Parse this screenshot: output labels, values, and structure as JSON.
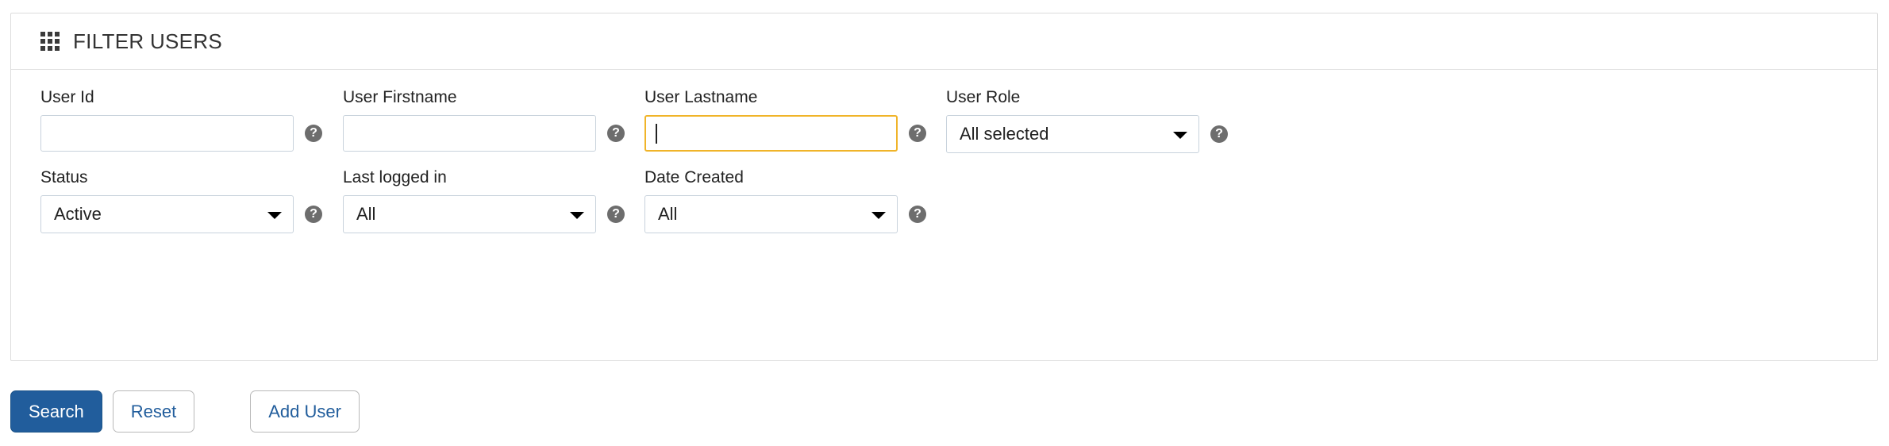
{
  "panel": {
    "icon": "grid-3x3-icon",
    "title": "FILTER USERS"
  },
  "help_icon_glyph": "?",
  "fields": {
    "user_id": {
      "label": "User Id",
      "type": "text",
      "value": "",
      "placeholder": "",
      "help": "?"
    },
    "user_firstname": {
      "label": "User Firstname",
      "type": "text",
      "value": "",
      "placeholder": "",
      "help": "?"
    },
    "user_lastname": {
      "label": "User Lastname",
      "type": "text",
      "value": "",
      "placeholder": "",
      "focused": true,
      "help": "?"
    },
    "user_role": {
      "label": "User Role",
      "type": "select",
      "value": "All selected",
      "help": "?"
    },
    "status": {
      "label": "Status",
      "type": "select",
      "value": "Active",
      "help": "?"
    },
    "last_logged_in": {
      "label": "Last logged in",
      "type": "select",
      "value": "All",
      "help": "?"
    },
    "date_created": {
      "label": "Date Created",
      "type": "select",
      "value": "All",
      "help": "?"
    }
  },
  "buttons": {
    "search": "Search",
    "reset": "Reset",
    "add_user": "Add User"
  },
  "colors": {
    "primary_blue": "#215d9c",
    "focus_amber": "#f0b429",
    "input_border": "#c8d2dc",
    "panel_border": "#dddddd",
    "help_icon_bg": "#6d6d6d"
  }
}
